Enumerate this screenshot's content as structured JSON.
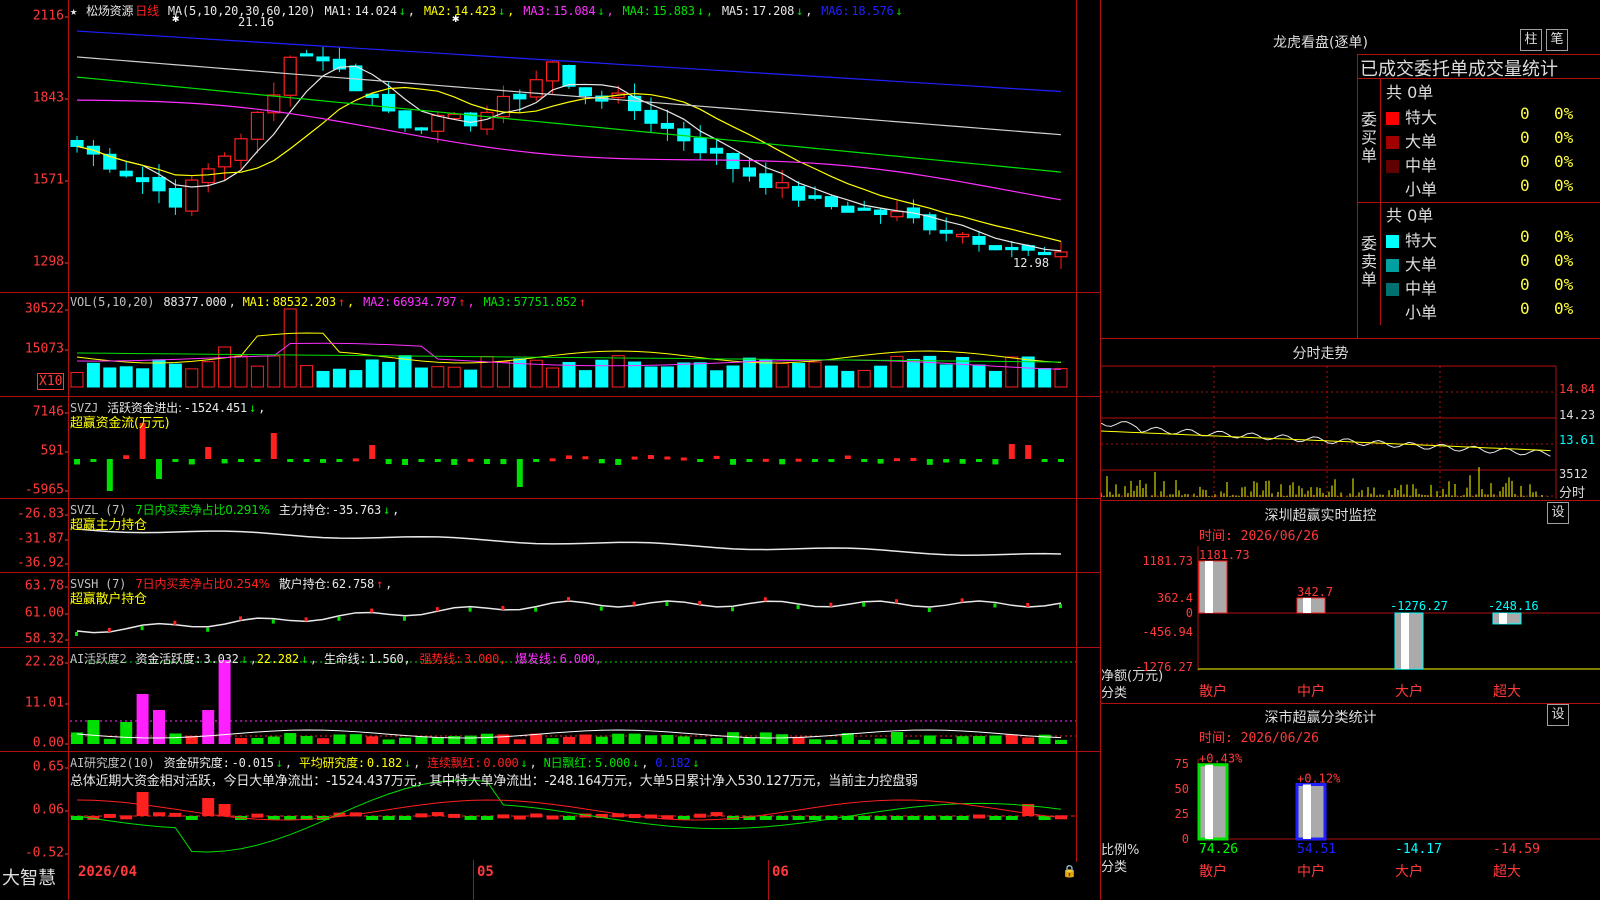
{
  "app": {
    "logo": "大智慧",
    "stock_name": "松炀资源",
    "period": "日线",
    "star": "★"
  },
  "main": {
    "ma_label": "MA(5,10,20,30,60,120)",
    "ma": [
      {
        "label": "MA1:",
        "value": "14.024",
        "dir": "↓",
        "color": "#e8e8e8"
      },
      {
        "label": "MA2:",
        "value": "14.423",
        "dir": "↓",
        "color": "#ffff00"
      },
      {
        "label": "MA3:",
        "value": "15.084",
        "dir": "↓",
        "color": "#ff30ff"
      },
      {
        "label": "MA4:",
        "value": "15.883",
        "dir": "↓",
        "color": "#00e000"
      },
      {
        "label": "MA5:",
        "value": "17.208",
        "dir": "↓",
        "color": "#e8e8e8"
      },
      {
        "label": "MA6:",
        "value": "18.576",
        "dir": "↓",
        "color": "#2020ff"
      }
    ],
    "ticks": [
      "2116",
      "1843",
      "1571",
      "1298"
    ],
    "high_label": "21.16",
    "low_label": "12.98"
  },
  "vol": {
    "label": "VOL(5,10,20)",
    "value": "88377.000",
    "ma": [
      {
        "label": "MA1:",
        "value": "88532.203",
        "dir": "↑",
        "color": "#ffff00"
      },
      {
        "label": "MA2:",
        "value": "66934.797",
        "dir": "↑",
        "color": "#ff30ff"
      },
      {
        "label": "MA3:",
        "value": "57751.852",
        "dir": "↑",
        "color": "#00e000"
      }
    ],
    "ticks": [
      "30522",
      "15073"
    ],
    "unit": "X10"
  },
  "svzj": {
    "label": "SVZJ",
    "desc": "活跃资金进出:",
    "value": "-1524.451",
    "dir": "↓",
    "suffix": ",",
    "sub": "超赢资金流(万元)",
    "ticks": [
      "7146",
      "591",
      "-5965"
    ]
  },
  "svzl": {
    "label": "SVZL (7)",
    "desc": "7日内买卖净占比0.291%",
    "desc2": "主力持仓:",
    "value": "-35.763",
    "dir": "↓",
    "suffix": ",",
    "sub": "超赢主力持仓",
    "ticks": [
      "-26.83",
      "-31.87",
      "-36.92"
    ]
  },
  "svsh": {
    "label": "SVSH (7)",
    "desc": "7日内买卖净占比0.254%",
    "desc2": "散户持仓:",
    "value": "62.758",
    "dir": "↑",
    "suffix": ",",
    "sub": "超赢散户持仓",
    "ticks": [
      "63.78",
      "61.00",
      "58.32"
    ]
  },
  "ai1": {
    "label": "AI活跃度2",
    "desc": "资金活跃度:",
    "value": "3.032",
    "dir": "↓",
    "v2": "22.282",
    "dir2": "↓",
    "life": "生命线:",
    "life_v": "1.560,",
    "strong": "强势线:",
    "strong_v": "3.000,",
    "burst": "爆发线:",
    "burst_v": "6.000,",
    "ticks": [
      "22.28",
      "11.01",
      "0.00"
    ]
  },
  "ai2": {
    "label": "AI研究度2(10)",
    "desc": "资金研究度:",
    "value": "-0.015",
    "dir": "↓",
    "avg": "平均研究度:",
    "avg_v": "0.182",
    "avg_dir": "↓",
    "cont": "连续飘红:",
    "cont_v": "0.000",
    "cont_dir": "↓",
    "nday": "N日飘红:",
    "nday_v": "5.000",
    "nday_dir": "↓",
    "last": "0.182",
    "last_dir": "↓",
    "summary": "总体近期大资金相对活跃，今日大单净流出：-1524.437万元，其中特大单净流出：-248.164万元，大单5日累计净入530.127万元，当前主力控盘弱",
    "ticks": [
      "0.65",
      "0.06",
      "-0.52"
    ]
  },
  "xaxis": {
    "start": "2026/04",
    "m1": "05",
    "m2": "06"
  },
  "lhb": {
    "title": "龙虎看盘(逐单)",
    "btn1": "柱",
    "btn2": "笔",
    "header": "已成交委托单成交量统计",
    "buy_label": "委买单",
    "sell_label": "委卖单",
    "buy_total": "共 0单",
    "sell_total": "共 0单",
    "buy_rows": [
      {
        "label": "特大",
        "value": "0",
        "pct": "0%",
        "color": "#ff0000"
      },
      {
        "label": "大单",
        "value": "0",
        "pct": "0%",
        "color": "#a00000"
      },
      {
        "label": "中单",
        "value": "0",
        "pct": "0%",
        "color": "#600000"
      },
      {
        "label": "小单",
        "value": "0",
        "pct": "0%",
        "color": "#000000"
      }
    ],
    "sell_rows": [
      {
        "label": "特大",
        "value": "0",
        "pct": "0%",
        "color": "#00ffff"
      },
      {
        "label": "大单",
        "value": "0",
        "pct": "0%",
        "color": "#00a0a0"
      },
      {
        "label": "中单",
        "value": "0",
        "pct": "0%",
        "color": "#007070"
      },
      {
        "label": "小单",
        "value": "0",
        "pct": "0%",
        "color": "#000000"
      }
    ]
  },
  "intraday": {
    "title": "分时走势",
    "ticks": [
      "14.84",
      "14.23",
      "13.61",
      "3512"
    ],
    "unit": "分时"
  },
  "monitor": {
    "title": "深圳超赢实时监控",
    "btn": "设",
    "time": "时间: 2026/06/26",
    "y_label": "净额(万元)",
    "x_label": "分类",
    "ticks": [
      "1181.73",
      "362.4",
      "0",
      "-456.94",
      "-1276.27"
    ],
    "categories": [
      "散户",
      "中户",
      "大户",
      "超大"
    ],
    "values": [
      "1181.73",
      "342.7",
      "-1276.27",
      "-248.16"
    ]
  },
  "classify": {
    "title": "深市超赢分类统计",
    "btn": "设",
    "time": "时间: 2026/06/26",
    "y_label": "比例%",
    "x_label": "分类",
    "ticks": [
      "75",
      "50",
      "25",
      "0"
    ],
    "categories": [
      "散户",
      "中户",
      "大户",
      "超大"
    ],
    "values": [
      "74.26",
      "54.51",
      "-14.17",
      "-14.59"
    ],
    "top": [
      "+0.43%",
      "+0.12%"
    ]
  },
  "colors": {
    "up": "#ff2020",
    "down": "#00ffff",
    "grid": "#b01010",
    "tick": "#ff3a3a"
  }
}
